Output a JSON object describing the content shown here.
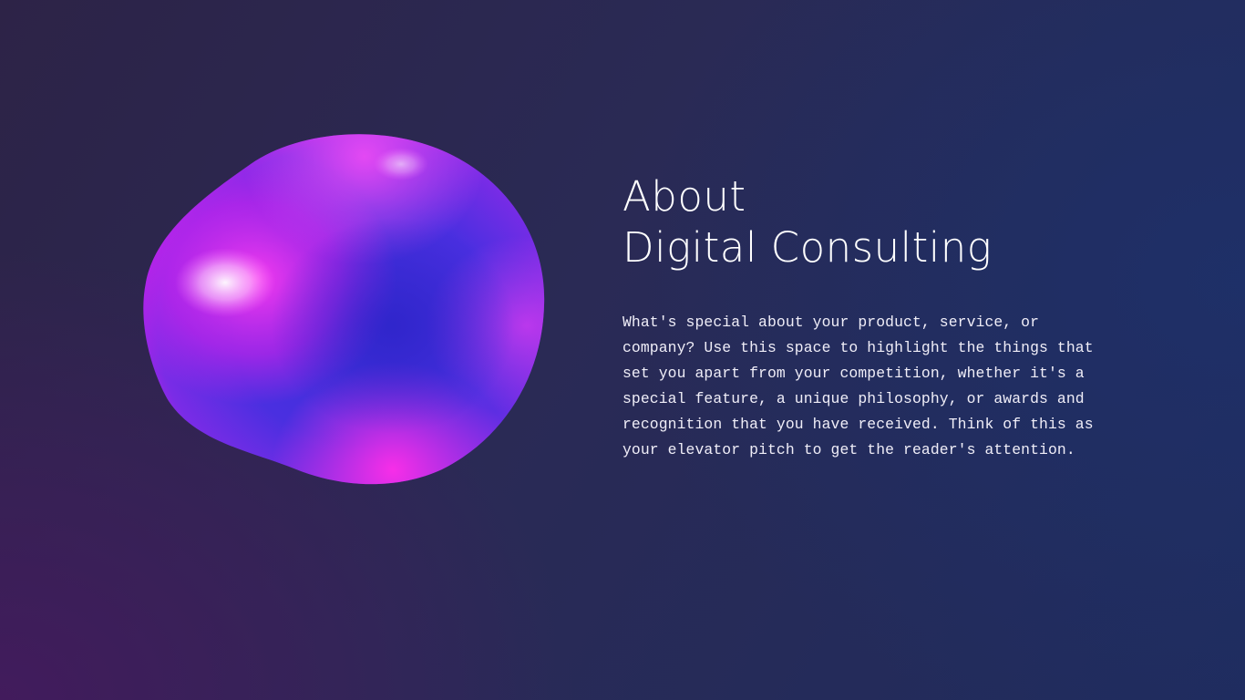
{
  "about": {
    "title_line1": "About",
    "title_line2": "Digital Consulting",
    "paragraph": "What's special about your product, service, or company? Use this space to highlight the things that set you apart from your competition, whether it's a special feature, a unique philosophy, or awards and recognition that you have received. Think of this as your elevator pitch to get the reader's attention."
  },
  "colors": {
    "background_left": "#3b1f56",
    "background_right": "#1f2c5e",
    "blob_blue": "#3a2ee0",
    "blob_magenta": "#e21ee8",
    "text": "#ffffff"
  },
  "media": {
    "blob_image": "iridescent-sphere-illustration"
  }
}
